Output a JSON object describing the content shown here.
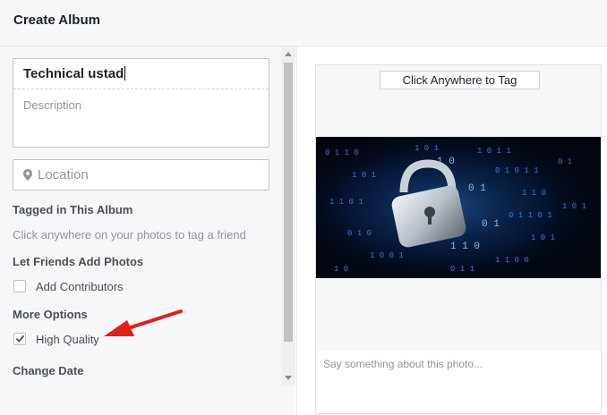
{
  "header": {
    "title": "Create Album"
  },
  "form": {
    "album_title": "Technical ustad",
    "description_placeholder": "Description",
    "location_placeholder": "Location"
  },
  "tagged": {
    "heading": "Tagged in This Album",
    "hint": "Click anywhere on your photos to tag a friend"
  },
  "friends": {
    "heading": "Let Friends Add Photos",
    "contributors_label": "Add Contributors",
    "contributors_checked": false
  },
  "options": {
    "heading": "More Options",
    "high_quality_label": "High Quality",
    "high_quality_checked": true
  },
  "change_date": {
    "heading": "Change Date"
  },
  "photo": {
    "tag_button": "Click Anywhere to Tag",
    "caption_placeholder": "Say something about this photo..."
  },
  "colors": {
    "accent_arrow": "#e0201b",
    "panel_bg": "#f6f7f9",
    "photo_glow": "#1e6fd9"
  },
  "icons": [
    "location-pin-icon",
    "checkmark-icon",
    "padlock-icon",
    "red-arrow-annotation"
  ]
}
